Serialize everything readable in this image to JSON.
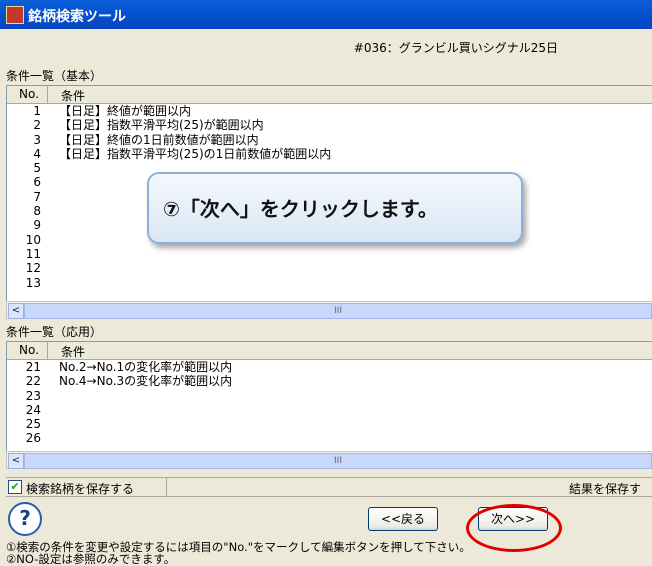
{
  "window": {
    "title": "銘柄検索ツール"
  },
  "strategy_label": "#036：グランビル買いシグナル25日",
  "basic": {
    "section_label": "条件一覧（基本）",
    "col_no": "No.",
    "col_condition": "条件",
    "rows": [
      {
        "no": "1",
        "text": "【日足】終値が範囲以内"
      },
      {
        "no": "2",
        "text": "【日足】指数平滑平均(25)が範囲以内"
      },
      {
        "no": "3",
        "text": "【日足】終値の1日前数値が範囲以内"
      },
      {
        "no": "4",
        "text": "【日足】指数平滑平均(25)の1日前数値が範囲以内"
      },
      {
        "no": "5",
        "text": ""
      },
      {
        "no": "6",
        "text": ""
      },
      {
        "no": "7",
        "text": ""
      },
      {
        "no": "8",
        "text": ""
      },
      {
        "no": "9",
        "text": ""
      },
      {
        "no": "10",
        "text": ""
      },
      {
        "no": "11",
        "text": ""
      },
      {
        "no": "12",
        "text": ""
      },
      {
        "no": "13",
        "text": ""
      }
    ]
  },
  "applied": {
    "section_label": "条件一覧（応用）",
    "col_no": "No.",
    "col_condition": "条件",
    "rows": [
      {
        "no": "21",
        "text": "No.2→No.1の変化率が範囲以内"
      },
      {
        "no": "22",
        "text": "No.4→No.3の変化率が範囲以内"
      },
      {
        "no": "23",
        "text": ""
      },
      {
        "no": "24",
        "text": ""
      },
      {
        "no": "25",
        "text": ""
      },
      {
        "no": "26",
        "text": ""
      }
    ]
  },
  "scroll_left_arrow": "<",
  "scroll_thumb_mark": "III",
  "save_bar": {
    "checkbox_mark": "✔",
    "save_stocks_label": "検索銘柄を保存する",
    "save_results_label": "結果を保存す"
  },
  "help_symbol": "?",
  "buttons": {
    "back": "<<戻る",
    "next": "次へ>>"
  },
  "footer_lines": [
    "①検索の条件を変更や設定するには項目の\"No.\"をマークして編集ボタンを押して下さい。",
    "②NO-設定は参照のみできます。"
  ],
  "callout": "⑦「次へ」をクリックします。"
}
